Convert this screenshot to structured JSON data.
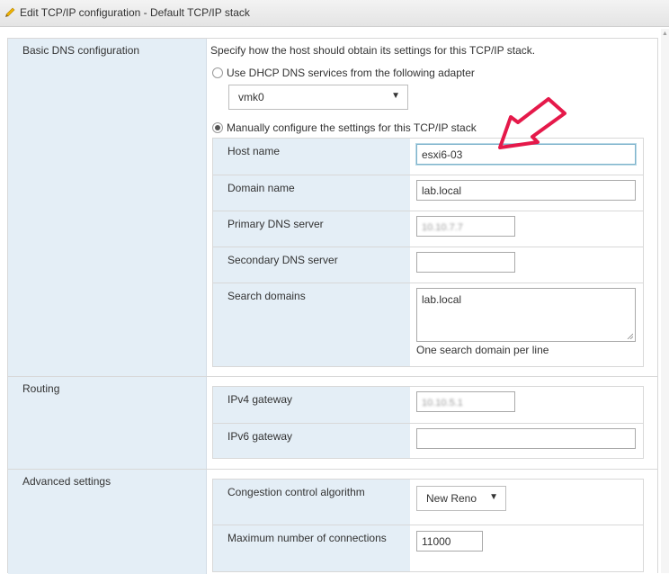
{
  "dialog": {
    "title": "Edit TCP/IP configuration - Default TCP/IP stack"
  },
  "dns": {
    "section_label": "Basic DNS configuration",
    "description": "Specify how the host should obtain its settings for this TCP/IP stack.",
    "dhcp_option_label": "Use DHCP DNS services from the following adapter",
    "dhcp_selected": false,
    "adapter_value": "vmk0",
    "manual_option_label": "Manually configure the settings for this TCP/IP stack",
    "manual_selected": true,
    "host_name_label": "Host name",
    "host_name_value": "esxi6-03",
    "domain_name_label": "Domain name",
    "domain_name_value": "lab.local",
    "primary_dns_label": "Primary DNS server",
    "primary_dns_value": "10.10.7.7",
    "secondary_dns_label": "Secondary DNS server",
    "secondary_dns_value": "",
    "search_domains_label": "Search domains",
    "search_domains_value": "lab.local",
    "search_domains_hint": "One search domain per line"
  },
  "routing": {
    "section_label": "Routing",
    "ipv4_label": "IPv4 gateway",
    "ipv4_value": "10.10.5.1",
    "ipv6_label": "IPv6 gateway",
    "ipv6_value": ""
  },
  "advanced": {
    "section_label": "Advanced settings",
    "congestion_label": "Congestion control algorithm",
    "congestion_value": "New Reno",
    "max_connections_label": "Maximum number of connections",
    "max_connections_value": "11000"
  },
  "icons": {
    "title_icon": "pencil-icon",
    "dropdown_icon": "triangle-down-icon",
    "annotation": "red-arrow-annotation"
  },
  "colors": {
    "label_background": "#e4eef6",
    "annotation_red": "#e5194a",
    "focus_border": "#7eb3cb"
  }
}
